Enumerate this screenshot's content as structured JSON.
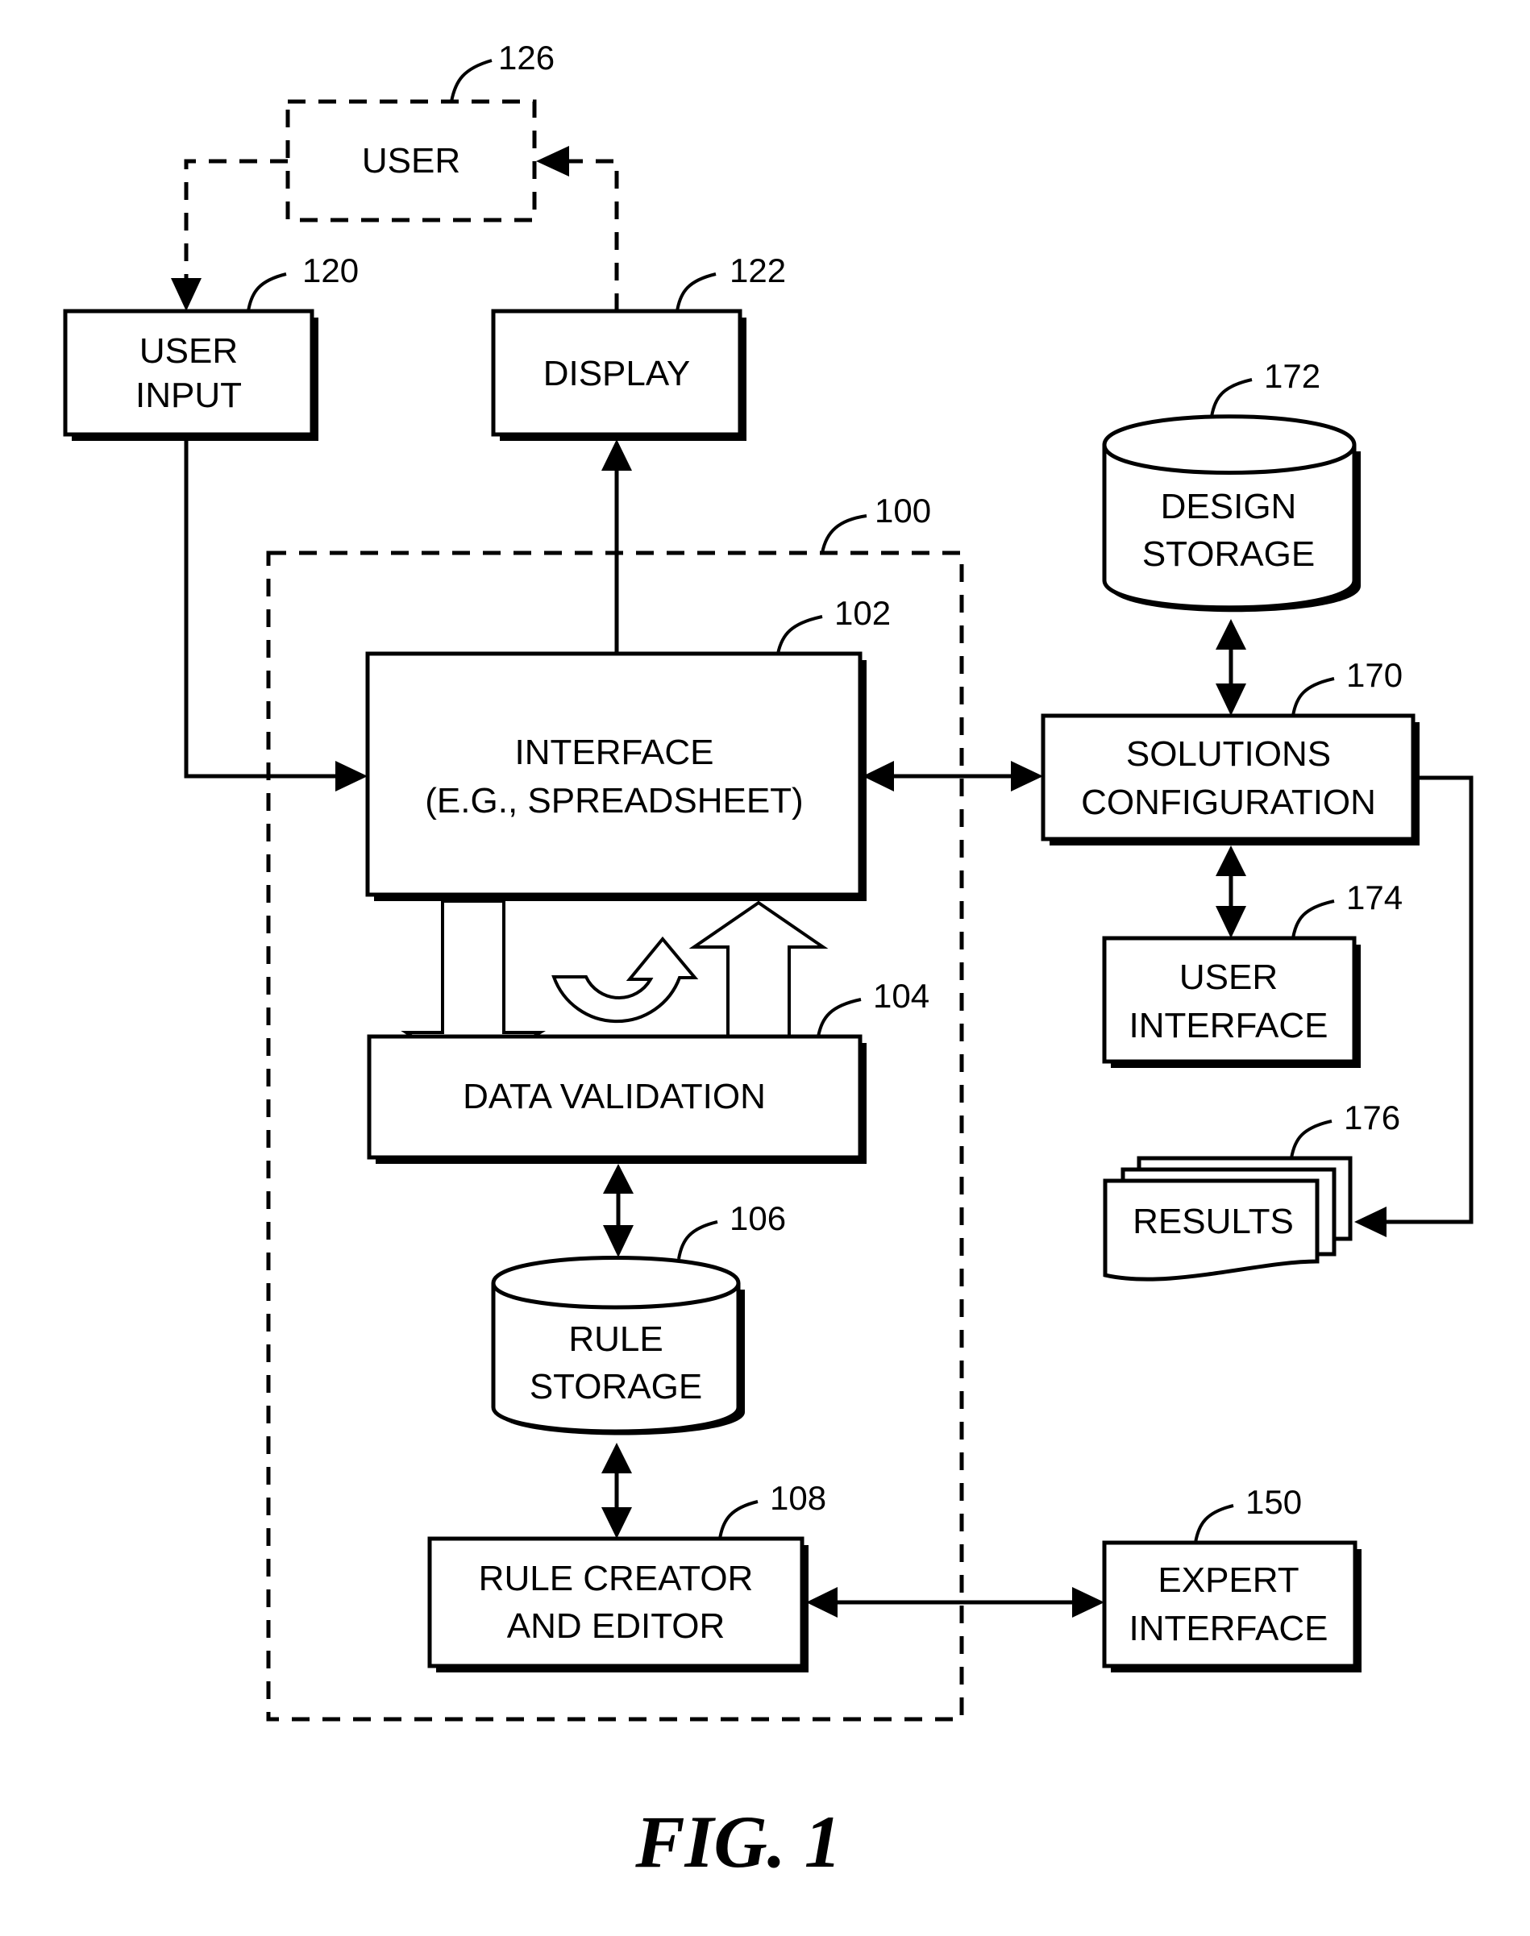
{
  "figure": {
    "caption": "FIG. 1",
    "elements": {
      "user": {
        "ref": "126",
        "lines": [
          "USER"
        ]
      },
      "user_input": {
        "ref": "120",
        "lines": [
          "USER",
          "INPUT"
        ]
      },
      "display": {
        "ref": "122",
        "lines": [
          "DISPLAY"
        ]
      },
      "system": {
        "ref": "100"
      },
      "interface": {
        "ref": "102",
        "lines": [
          "INTERFACE",
          "(E.G., SPREADSHEET)"
        ]
      },
      "data_validation": {
        "ref": "104",
        "lines": [
          "DATA VALIDATION"
        ]
      },
      "rule_storage": {
        "ref": "106",
        "lines": [
          "RULE",
          "STORAGE"
        ]
      },
      "rule_creator": {
        "ref": "108",
        "lines": [
          "RULE CREATOR",
          "AND EDITOR"
        ]
      },
      "expert_interface": {
        "ref": "150",
        "lines": [
          "EXPERT",
          "INTERFACE"
        ]
      },
      "design_storage": {
        "ref": "172",
        "lines": [
          "DESIGN",
          "STORAGE"
        ]
      },
      "solutions_configuration": {
        "ref": "170",
        "lines": [
          "SOLUTIONS",
          "CONFIGURATION"
        ]
      },
      "user_interface": {
        "ref": "174",
        "lines": [
          "USER",
          "INTERFACE"
        ]
      },
      "results": {
        "ref": "176",
        "lines": [
          "RESULTS"
        ]
      }
    },
    "connections": [
      {
        "from": "user",
        "to": "user_input",
        "style": "dashed",
        "direction": "one-way"
      },
      {
        "from": "display",
        "to": "user",
        "style": "dashed",
        "direction": "one-way"
      },
      {
        "from": "user_input",
        "to": "interface",
        "style": "solid",
        "direction": "one-way"
      },
      {
        "from": "interface",
        "to": "display",
        "style": "solid",
        "direction": "one-way"
      },
      {
        "from": "interface",
        "to": "data_validation",
        "style": "hollow-arrow",
        "direction": "one-way"
      },
      {
        "from": "data_validation",
        "to": "interface",
        "style": "hollow-arrow",
        "direction": "one-way"
      },
      {
        "from": "data_validation",
        "to": "rule_storage",
        "style": "solid",
        "direction": "two-way"
      },
      {
        "from": "rule_storage",
        "to": "rule_creator",
        "style": "solid",
        "direction": "two-way"
      },
      {
        "from": "rule_creator",
        "to": "expert_interface",
        "style": "solid",
        "direction": "two-way"
      },
      {
        "from": "interface",
        "to": "solutions_configuration",
        "style": "solid",
        "direction": "two-way"
      },
      {
        "from": "design_storage",
        "to": "solutions_configuration",
        "style": "solid",
        "direction": "two-way"
      },
      {
        "from": "solutions_configuration",
        "to": "user_interface",
        "style": "solid",
        "direction": "two-way"
      },
      {
        "from": "solutions_configuration",
        "to": "results",
        "style": "solid",
        "direction": "one-way"
      }
    ]
  }
}
